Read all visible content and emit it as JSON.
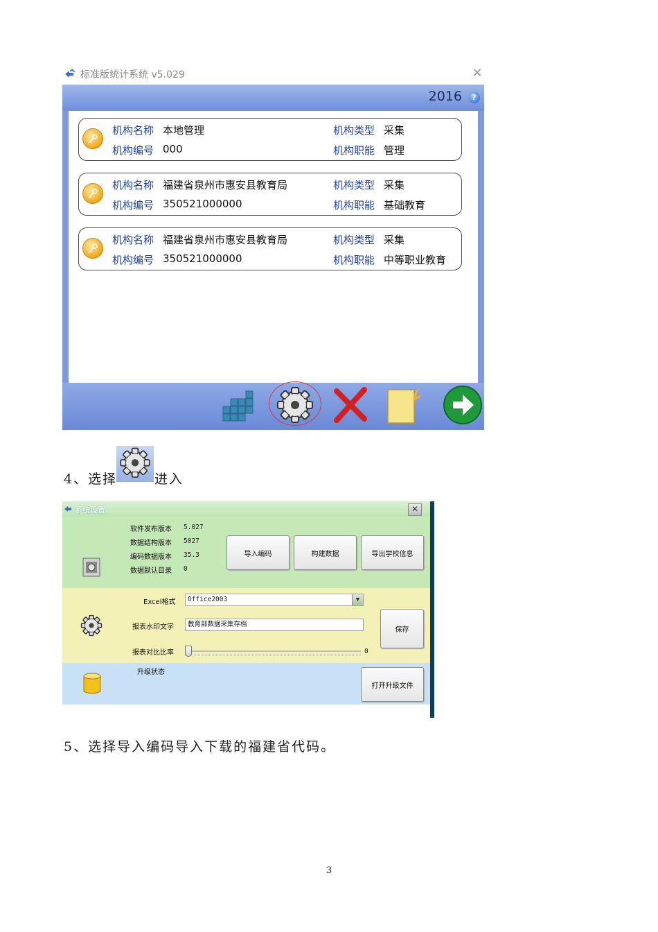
{
  "window1": {
    "title": "标准版统计系统 v5.029",
    "year": "2016",
    "labels": {
      "name": "机构名称",
      "code": "机构编号",
      "type": "机构类型",
      "function": "机构职能"
    },
    "orgs": [
      {
        "name": "本地管理",
        "code": "000",
        "type": "采集",
        "function": "管理"
      },
      {
        "name": "福建省泉州市惠安县教育局",
        "code": "350521000000",
        "type": "采集",
        "function": "基础教育"
      },
      {
        "name": "福建省泉州市惠安县教育局",
        "code": "350521000000",
        "type": "采集",
        "function": "中等职业教育"
      }
    ],
    "toolbar_icons": [
      "database-blocks-icon",
      "settings-gear-icon",
      "delete-x-icon",
      "new-document-icon",
      "next-arrow-icon"
    ]
  },
  "step4": {
    "prefix": "4、选择",
    "suffix": "进入"
  },
  "window2": {
    "title": "系统设置",
    "info": [
      {
        "label": "软件发布版本",
        "value": "5.027"
      },
      {
        "label": "数据结构版本",
        "value": "5027"
      },
      {
        "label": "编码数据版本",
        "value": "35.3"
      },
      {
        "label": "数据默认目录",
        "value": "0"
      }
    ],
    "buttons": {
      "import_code": "导入编码",
      "build_data": "构建数据",
      "export_school": "导出学校信息",
      "save": "保存",
      "open_upgrade": "打开升级文件"
    },
    "excel_format_label": "Excel格式",
    "excel_format_value": "Office2003",
    "watermark_label": "报表水印文字",
    "watermark_value": "教育部数据采集存档",
    "contrast_label": "报表对比比率",
    "contrast_value": "0",
    "contrast_level": 0,
    "upgrade_label": "升级状态"
  },
  "step5": "5、选择导入编码导入下载的福建省代码。",
  "page_number": "3"
}
